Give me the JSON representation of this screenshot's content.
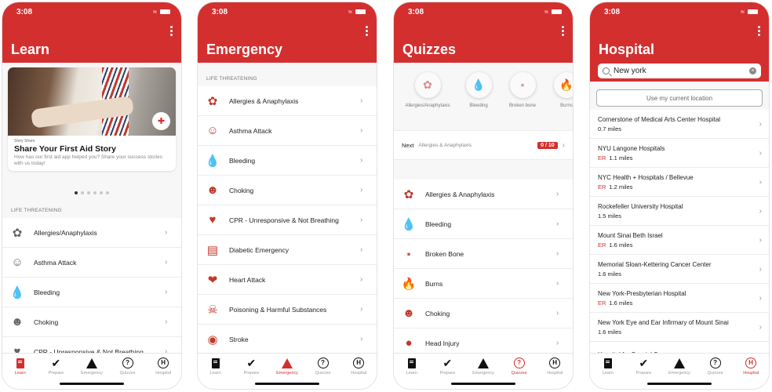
{
  "status_time": "3:08",
  "colors": {
    "brand_red": "#d42f2f",
    "active_tab": "#d42f2f"
  },
  "tab_bar": [
    {
      "label": "Learn",
      "icon": "book-icon"
    },
    {
      "label": "Prepare",
      "icon": "checkmark-icon"
    },
    {
      "label": "Emergency",
      "icon": "warning-icon"
    },
    {
      "label": "Quizzes",
      "icon": "question-circle-icon"
    },
    {
      "label": "Hospital",
      "icon": "hospital-h-icon"
    }
  ],
  "learn": {
    "title": "Learn",
    "card": {
      "kicker": "Story Share",
      "title": "Share Your First Aid Story",
      "description": "How has our first aid app helped you? Share your success stories with us today!"
    },
    "carousel": {
      "count": 6,
      "active": 1
    },
    "section": "LIFE THREATENING",
    "items": [
      {
        "label": "Allergies/Anaphylaxis",
        "icon": "allergy-icon"
      },
      {
        "label": "Asthma Attack",
        "icon": "asthma-icon"
      },
      {
        "label": "Bleeding",
        "icon": "blood-drop-icon"
      },
      {
        "label": "Choking",
        "icon": "choking-icon"
      },
      {
        "label": "CPR - Unresponsive & Not Breathing",
        "icon": "cpr-icon"
      }
    ],
    "active_tab": 0
  },
  "emergency": {
    "title": "Emergency",
    "section": "LIFE THREATENING",
    "items": [
      {
        "label": "Allergies & Anaphylaxis",
        "icon": "allergy-icon"
      },
      {
        "label": "Asthma Attack",
        "icon": "asthma-icon"
      },
      {
        "label": "Bleeding",
        "icon": "blood-drop-icon"
      },
      {
        "label": "Choking",
        "icon": "choking-icon"
      },
      {
        "label": "CPR - Unresponsive & Not Breathing",
        "icon": "cpr-icon"
      },
      {
        "label": "Diabetic Emergency",
        "icon": "diabetic-icon"
      },
      {
        "label": "Heart Attack",
        "icon": "heart-icon"
      },
      {
        "label": "Poisoning & Harmful Substances",
        "icon": "skull-icon"
      },
      {
        "label": "Stroke",
        "icon": "stroke-icon"
      }
    ],
    "active_tab": 2
  },
  "quizzes": {
    "title": "Quizzes",
    "categories": [
      {
        "label": "Allergies/Anaphylaxis",
        "icon": "allergy-icon"
      },
      {
        "label": "Bleeding",
        "icon": "blood-drop-icon"
      },
      {
        "label": "Broken bone",
        "icon": "bone-icon"
      },
      {
        "label": "Burns",
        "icon": "flame-icon"
      }
    ],
    "next": {
      "label": "Next",
      "topic": "Allergies & Anaphylaxis",
      "score": "0 / 10"
    },
    "items": [
      {
        "label": "Allergies & Anaphylaxis",
        "icon": "allergy-icon"
      },
      {
        "label": "Bleeding",
        "icon": "blood-drop-icon"
      },
      {
        "label": "Broken Bone",
        "icon": "bone-icon"
      },
      {
        "label": "Burns",
        "icon": "flame-icon"
      },
      {
        "label": "Choking",
        "icon": "choking-icon"
      },
      {
        "label": "Head Injury",
        "icon": "head-injury-icon"
      }
    ],
    "active_tab": 3
  },
  "hospital": {
    "title": "Hospital",
    "search_value": "New york",
    "location_button": "Use my current location",
    "er_label": "ER",
    "items": [
      {
        "name": "Cornerstone of Medical Arts Center Hospital",
        "distance": "0.7 miles",
        "er": false
      },
      {
        "name": "NYU Langone Hospitals",
        "distance": "1.1 miles",
        "er": true
      },
      {
        "name": "NYC Health + Hospitals / Bellevue",
        "distance": "1.2 miles",
        "er": true
      },
      {
        "name": "Rockefeller University Hospital",
        "distance": "1.5 miles",
        "er": false
      },
      {
        "name": "Mount Sinai Beth Israel",
        "distance": "1.6 miles",
        "er": true
      },
      {
        "name": "Memorial Sloan-Kettering Cancer Center",
        "distance": "1.6 miles",
        "er": false
      },
      {
        "name": "New York-Presbyterian Hospital",
        "distance": "1.6 miles",
        "er": true
      },
      {
        "name": "New York Eye and Ear Infirmary of Mount Sinai",
        "distance": "1.6 miles",
        "er": false
      },
      {
        "name": "Hospital for Special Surgery",
        "distance": "",
        "er": false
      }
    ],
    "active_tab": 4
  }
}
